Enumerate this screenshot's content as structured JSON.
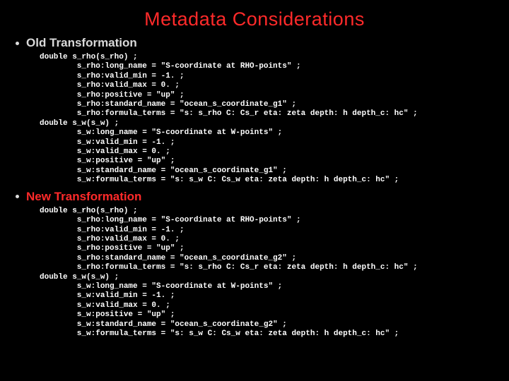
{
  "title": "Metadata Considerations",
  "sections": {
    "old": {
      "label": "Old Transformation",
      "code": "double s_rho(s_rho) ;\n        s_rho:long_name = \"S-coordinate at RHO-points\" ;\n        s_rho:valid_min = -1. ;\n        s_rho:valid_max = 0. ;\n        s_rho:positive = \"up\" ;\n        s_rho:standard_name = \"ocean_s_coordinate_g1\" ;\n        s_rho:formula_terms = \"s: s_rho C: Cs_r eta: zeta depth: h depth_c: hc\" ;\ndouble s_w(s_w) ;\n        s_w:long_name = \"S-coordinate at W-points\" ;\n        s_w:valid_min = -1. ;\n        s_w:valid_max = 0. ;\n        s_w:positive = \"up\" ;\n        s_w:standard_name = \"ocean_s_coordinate_g1\" ;\n        s_w:formula_terms = \"s: s_w C: Cs_w eta: zeta depth: h depth_c: hc\" ;"
    },
    "new": {
      "label": "New Transformation",
      "code": "double s_rho(s_rho) ;\n        s_rho:long_name = \"S-coordinate at RHO-points\" ;\n        s_rho:valid_min = -1. ;\n        s_rho:valid_max = 0. ;\n        s_rho:positive = \"up\" ;\n        s_rho:standard_name = \"ocean_s_coordinate_g2\" ;\n        s_rho:formula_terms = \"s: s_rho C: Cs_r eta: zeta depth: h depth_c: hc\" ;\ndouble s_w(s_w) ;\n        s_w:long_name = \"S-coordinate at W-points\" ;\n        s_w:valid_min = -1. ;\n        s_w:valid_max = 0. ;\n        s_w:positive = \"up\" ;\n        s_w:standard_name = \"ocean_s_coordinate_g2\" ;\n        s_w:formula_terms = \"s: s_w C: Cs_w eta: zeta depth: h depth_c: hc\" ;"
    }
  }
}
